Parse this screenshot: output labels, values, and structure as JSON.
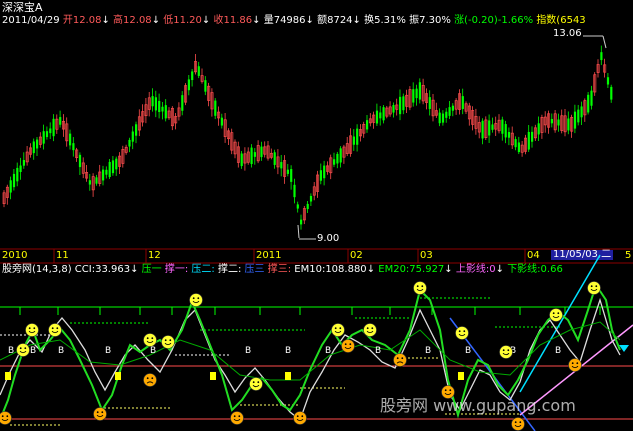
{
  "window_title": "深深宝A",
  "header": {
    "date": "2011/04/29",
    "open_label": "开12.08",
    "high_label": "高12.08",
    "low_label": "低11.20",
    "close_label": "收11.86",
    "volume_label": "量74986",
    "amount_label": "额8724",
    "turnover_label": "换5.31%",
    "amplitude_label": "振7.30%",
    "change_label": "涨(-0.20)-1.66%",
    "index_label": "指数(6543"
  },
  "price_chart": {
    "high_marker": "13.06",
    "low_marker": "9.00"
  },
  "time_axis": {
    "labels": [
      "2010",
      "11",
      "12",
      "2011",
      "02",
      "03",
      "04",
      "5"
    ],
    "cursor_date": "11/05/03,二"
  },
  "indicator_bar": {
    "name": "股旁网(14,3,8)",
    "cci": "CCI:33.963",
    "ya1": "压一",
    "cheng1": "撑一:",
    "ya2": "压二:",
    "cheng2": "撑二:",
    "ya3": "压三",
    "cheng3": "撑三:",
    "em10": "EM10:108.880",
    "em20": "EM20:75.927",
    "shangying": "上影线:0",
    "xiaying": "下影线:0.66"
  },
  "watermark": "股旁网 www.gupang.com",
  "colors": {
    "up": "#ff4d4d",
    "down": "#00ff00",
    "text_white": "#ffffff",
    "cyan": "#00e0ff",
    "blue": "#3366ff",
    "magenta": "#ff66ff",
    "yellow": "#ffff00",
    "grid_red": "#8b0000"
  },
  "icons": [
    "smiley-icon",
    "sad-face-icon",
    "down-arrow-icon",
    "b-marker-icon"
  ]
}
